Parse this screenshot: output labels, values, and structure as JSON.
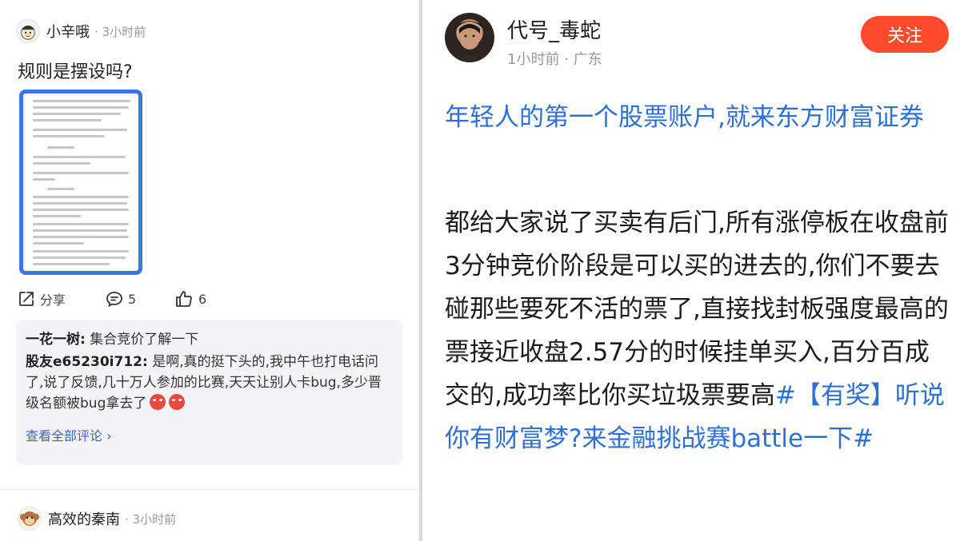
{
  "left_post": {
    "author": "小辛哦",
    "time": "· 3小时前",
    "title": "规则是摆设吗?",
    "actions": {
      "share": "分享",
      "comments": "5",
      "likes": "6"
    },
    "comments": [
      {
        "user": "一花一树:",
        "text": " 集合竞价了解一下"
      },
      {
        "user": "股友e65230i712:",
        "text": " 是啊,真的挺下头的,我中午也打电话问了,说了反馈,几十万人参加的比赛,天天让别人卡bug,多少晋级名额被bug拿去了"
      }
    ],
    "view_all": "查看全部评论 ›"
  },
  "left_post2": {
    "author": "高效的秦南",
    "time": "· 3小时前"
  },
  "right_post": {
    "author": "代号_毒蛇",
    "meta": "1小时前 · 广东",
    "follow": "关注",
    "headline": "年轻人的第一个股票账户,就来东方财富证券",
    "body": "都给大家说了买卖有后门,所有涨停板在收盘前3分钟竞价阶段是可以买的进去的,你们不要去碰那些要死不活的票了,直接找封板强度最高的票接近收盘2.57分的时候挂单买入,百分百成交的,成功率比你买垃圾票要高",
    "tag": "#【有奖】听说你有财富梦?来金融挑战赛battle一下#"
  },
  "colors": {
    "follow_button": "#ff4a2b",
    "link_blue": "#2f6fd6",
    "image_border": "#3d74e8"
  },
  "icons": [
    "share-icon",
    "comment-icon",
    "like-icon",
    "chevron-right-icon"
  ]
}
